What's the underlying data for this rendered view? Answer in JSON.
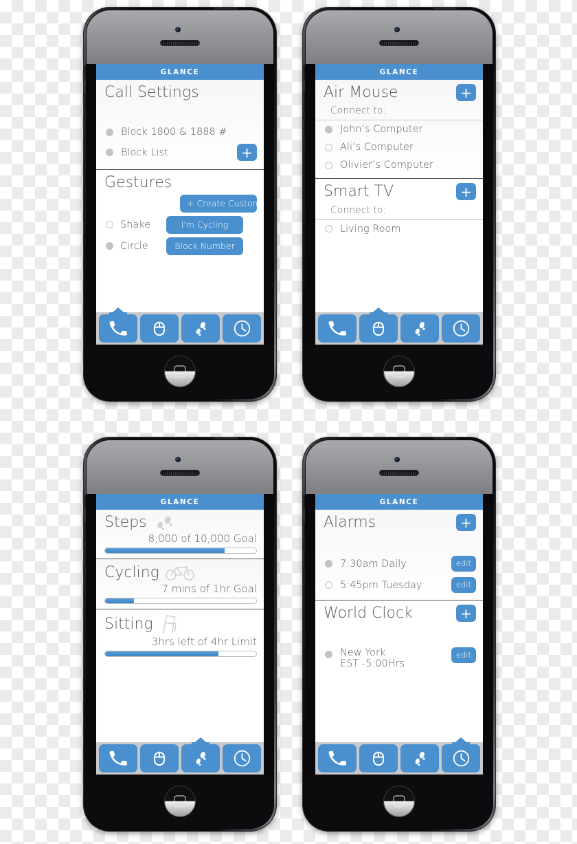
{
  "meta": {
    "accent_color": "#4a90ce",
    "text_color": "#58585b",
    "radio_color": "#c3c3c6",
    "tabbar_color": "#c9c9cc",
    "statusbar_label": "GLANCE"
  },
  "tabs": [
    {
      "name": "phone",
      "icon": "phone-icon"
    },
    {
      "name": "mouse",
      "icon": "mouse-icon"
    },
    {
      "name": "steps",
      "icon": "footsteps-icon"
    },
    {
      "name": "clock",
      "icon": "clock-icon"
    }
  ],
  "phones": [
    {
      "id": "call-settings",
      "statusbar": "GLANCE",
      "active_tab": 0,
      "cards": [
        {
          "title": "Call Settings",
          "has_plus": false,
          "rows": [
            {
              "radio": "filled",
              "label": "Block 1800 & 1888 #"
            },
            {
              "radio": "filled",
              "label": "Block List",
              "plus": "+"
            }
          ]
        },
        {
          "title": "Gestures",
          "has_plus": false,
          "gesture_rows": [
            {
              "radio": null,
              "label": "",
              "button": "+ Create Custom"
            },
            {
              "radio": "empty",
              "label": "Shake",
              "button": "I'm Cycling"
            },
            {
              "radio": "filled",
              "label": "Circle",
              "button": "Block Number"
            }
          ]
        }
      ]
    },
    {
      "id": "air-mouse",
      "statusbar": "GLANCE",
      "active_tab": 1,
      "cards": [
        {
          "title": "Air Mouse",
          "has_plus": true,
          "plus": "+",
          "sub_label": "Connect to:",
          "rows": [
            {
              "radio": "filled",
              "label": "John’s Computer"
            },
            {
              "radio": "empty",
              "label": "Ali’s Computer"
            },
            {
              "radio": "empty",
              "label": "Olivier’s Computer"
            }
          ]
        },
        {
          "title": "Smart TV",
          "has_plus": true,
          "plus": "+",
          "sub_label": "Connect to:",
          "rows": [
            {
              "radio": "empty",
              "label": "Living Room"
            }
          ]
        }
      ]
    },
    {
      "id": "activity",
      "statusbar": "GLANCE",
      "active_tab": 2,
      "stats": [
        {
          "title": "Steps",
          "icon": "footsteps-icon",
          "amount": "8,000 of 10,000 Goal",
          "percent": 79
        },
        {
          "title": "Cycling",
          "icon": "bicycle-icon",
          "amount": "7 mins of 1hr Goal",
          "percent": 19
        },
        {
          "title": "Sitting",
          "icon": "chair-icon",
          "amount": "3hrs left of 4hr Limit",
          "percent": 75
        }
      ]
    },
    {
      "id": "clock",
      "statusbar": "GLANCE",
      "active_tab": 3,
      "cards": [
        {
          "title": "Alarms",
          "has_plus": true,
          "plus": "+",
          "rows": [
            {
              "radio": "filled",
              "label": "7:30am Daily",
              "edit": "edit"
            },
            {
              "radio": "empty",
              "label": "5:45pm Tuesday",
              "edit": "edit"
            }
          ]
        },
        {
          "title": "World Clock",
          "has_plus": true,
          "plus": "+",
          "rows": [
            {
              "radio": "filled",
              "label": "New York",
              "sub": "EST -5:00Hrs",
              "edit": "edit"
            }
          ]
        }
      ]
    }
  ]
}
